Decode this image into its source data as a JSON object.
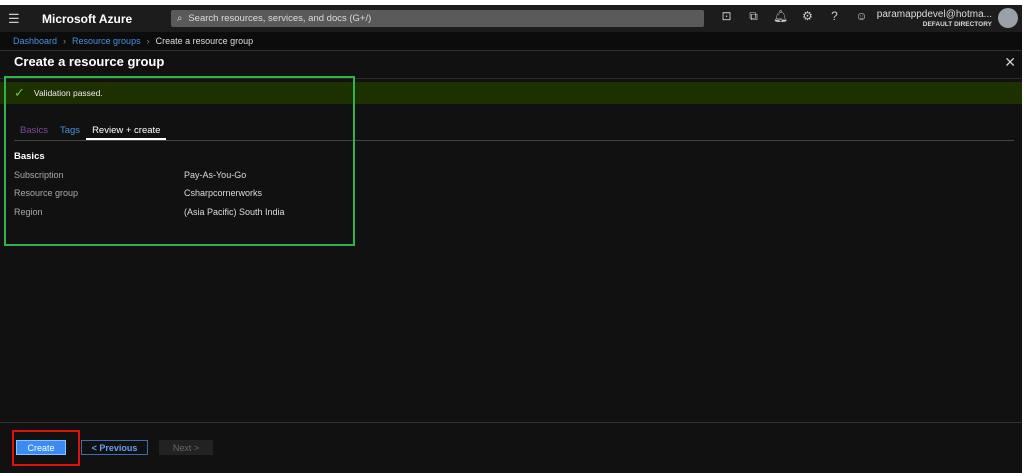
{
  "topbar": {
    "brand": "Microsoft Azure",
    "search_placeholder": "Search resources, services, and docs (G+/)",
    "user": "paramappdevel@hotma...",
    "directory": "DEFAULT DIRECTORY"
  },
  "breadcrumb": [
    "Dashboard",
    "Resource groups",
    "Create a resource group"
  ],
  "title": "Create a resource group",
  "banner": "Validation passed.",
  "tabs": [
    "Basics",
    "Tags",
    "Review + create"
  ],
  "section": "Basics",
  "fields": [
    {
      "k": "Subscription",
      "v": "Pay-As-You-Go"
    },
    {
      "k": "Resource group",
      "v": "Csharpcornerworks"
    },
    {
      "k": "Region",
      "v": "(Asia Pacific) South India"
    }
  ],
  "buttons": {
    "create": "Create",
    "previous": "< Previous",
    "next": "Next >"
  }
}
